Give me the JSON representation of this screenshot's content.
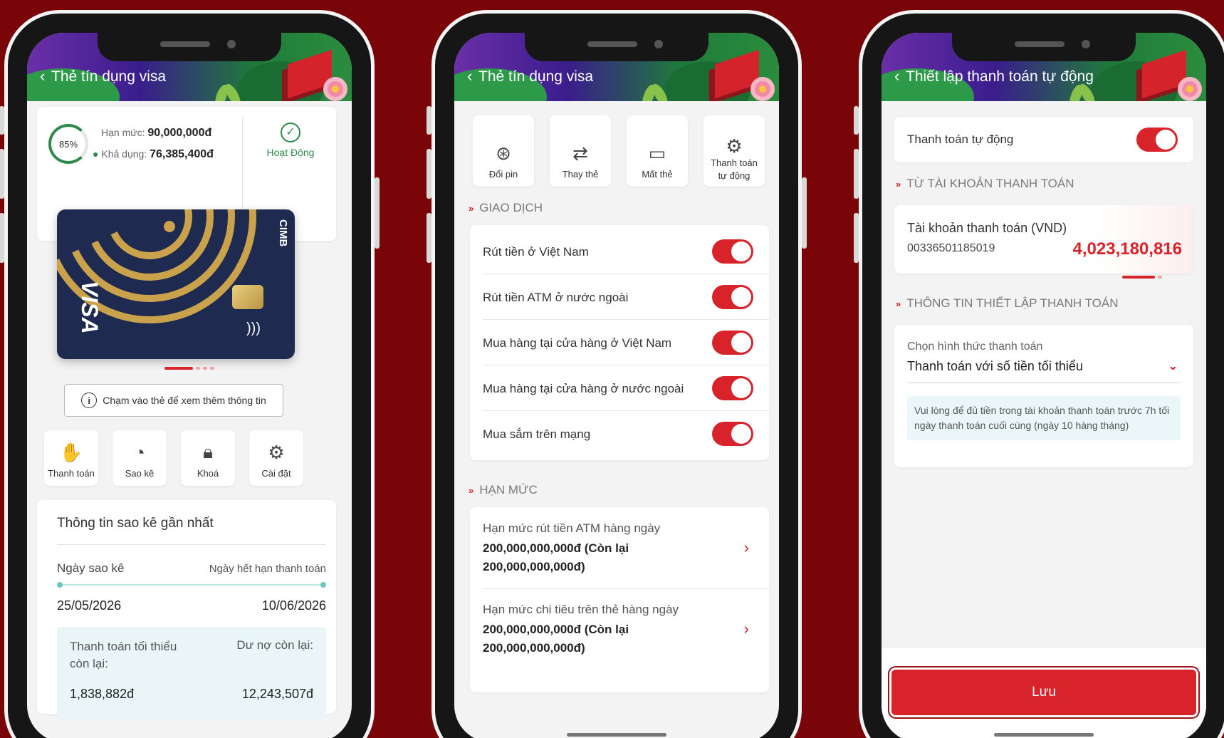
{
  "colors": {
    "background": "#7a0508",
    "accent": "#d8232a",
    "active_green": "#2f8a4a"
  },
  "phone1": {
    "title": "Thẻ tín dụng visa",
    "usage_percent": "85%",
    "limit_label": "Hạn mức:",
    "limit_value": "90,000,000đ",
    "available_label": "Khả dụng:",
    "available_value": "76,385,400đ",
    "status": "Hoạt Động",
    "card_brand": "VISA",
    "bank_brand": "CIMB",
    "hint": "Chạm vào thẻ để xem thêm thông tin",
    "actions": [
      {
        "label": "Thanh toán",
        "icon": "payment-icon"
      },
      {
        "label": "Sao kê",
        "icon": "statement-icon"
      },
      {
        "label": "Khoá",
        "icon": "lock-icon"
      },
      {
        "label": "Cài đặt",
        "icon": "settings-icon"
      }
    ],
    "statement_title": "Thông tin sao kê gần nhất",
    "statement_date_label": "Ngày sao kê",
    "due_date_label": "Ngày hết hạn thanh toán",
    "statement_date": "25/05/2026",
    "due_date": "10/06/2026",
    "min_payment_label": "Thanh toán tối thiểu còn lại:",
    "balance_label": "Dư nợ còn lại:",
    "min_payment_value": "1,838,882đ",
    "balance_value": "12,243,507đ"
  },
  "phone2": {
    "title": "Thẻ tín dụng visa",
    "quick_actions": [
      {
        "label": "Đổi pin",
        "icon": "change-pin-icon"
      },
      {
        "label": "Thay thẻ",
        "icon": "replace-card-icon"
      },
      {
        "label": "Mất thẻ",
        "icon": "lost-card-icon"
      },
      {
        "label": "Thanh toán tự động",
        "icon": "auto-payment-icon"
      }
    ],
    "transactions_section": "GIAO DỊCH",
    "toggles": [
      {
        "label": "Rút tiền ở Việt Nam",
        "on": true
      },
      {
        "label": "Rút tiền ATM ở nước ngoài",
        "on": true
      },
      {
        "label": "Mua hàng tại cửa hàng ở Việt Nam",
        "on": true
      },
      {
        "label": "Mua hàng tại cửa hàng ở nước ngoài",
        "on": true
      },
      {
        "label": "Mua sắm trên mạng",
        "on": true
      }
    ],
    "limits_section": "HẠN MỨC",
    "limits": [
      {
        "label": "Hạn mức rút tiền ATM hàng ngày",
        "line1": "200,000,000,000đ (Còn lại",
        "line2": "200,000,000,000đ)"
      },
      {
        "label": "Hạn mức chi tiêu trên thẻ hàng ngày",
        "line1": "200,000,000,000đ (Còn lại",
        "line2": "200,000,000,000đ)"
      }
    ]
  },
  "phone3": {
    "title": "Thiết lập thanh toán tự động",
    "auto_pay_label": "Thanh toán tự động",
    "auto_pay_on": true,
    "from_account_section": "TỪ TÀI KHOẢN THANH TOÁN",
    "account_name": "Tài khoản thanh toán (VND)",
    "account_number": "00336501185019",
    "account_balance": "4,023,180,816",
    "setup_section": "THÔNG TIN THIẾT LẬP THANH TOÁN",
    "method_label": "Chọn hình thức thanh toán",
    "method_value": "Thanh toán với số tiền tối thiểu",
    "notice": "Vui lòng để đủ tiền trong tài khoản thanh toán trước 7h tối ngày thanh toán cuối cùng (ngày 10 hàng tháng)",
    "save_label": "Lưu"
  }
}
